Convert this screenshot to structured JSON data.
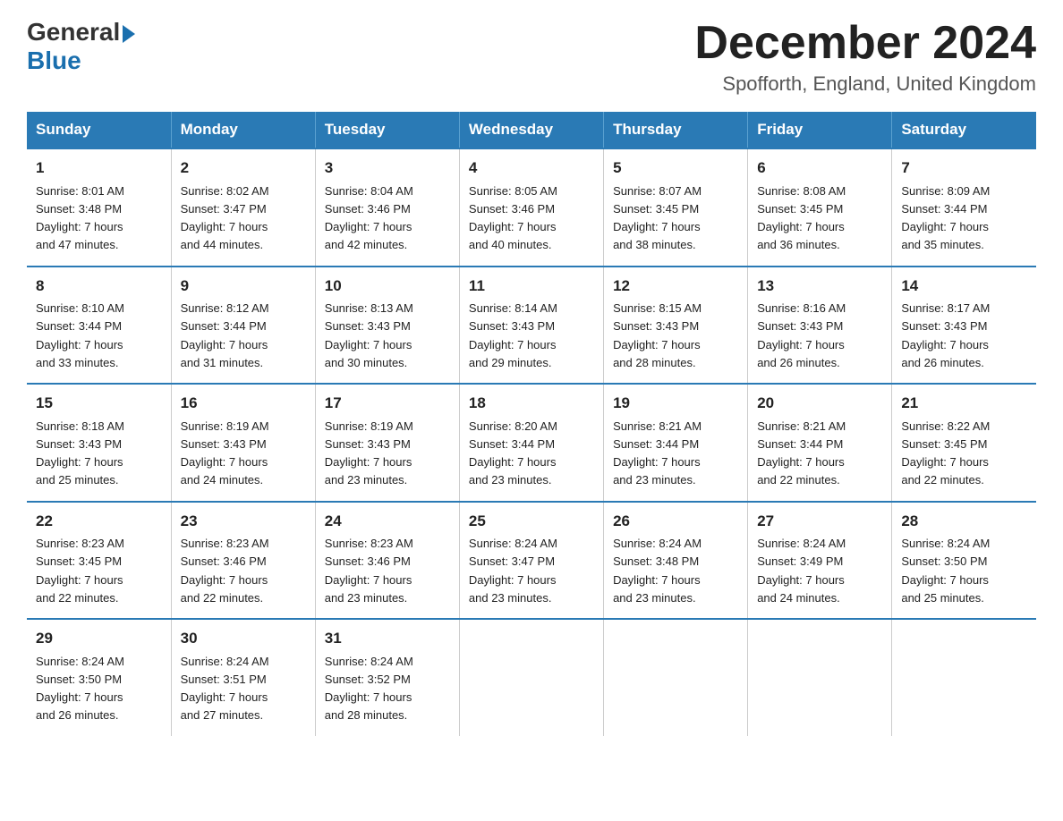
{
  "logo": {
    "general": "General",
    "blue": "Blue"
  },
  "title": "December 2024",
  "location": "Spofforth, England, United Kingdom",
  "days_of_week": [
    "Sunday",
    "Monday",
    "Tuesday",
    "Wednesday",
    "Thursday",
    "Friday",
    "Saturday"
  ],
  "weeks": [
    [
      {
        "day": "1",
        "sunrise": "8:01 AM",
        "sunset": "3:48 PM",
        "daylight": "7 hours and 47 minutes."
      },
      {
        "day": "2",
        "sunrise": "8:02 AM",
        "sunset": "3:47 PM",
        "daylight": "7 hours and 44 minutes."
      },
      {
        "day": "3",
        "sunrise": "8:04 AM",
        "sunset": "3:46 PM",
        "daylight": "7 hours and 42 minutes."
      },
      {
        "day": "4",
        "sunrise": "8:05 AM",
        "sunset": "3:46 PM",
        "daylight": "7 hours and 40 minutes."
      },
      {
        "day": "5",
        "sunrise": "8:07 AM",
        "sunset": "3:45 PM",
        "daylight": "7 hours and 38 minutes."
      },
      {
        "day": "6",
        "sunrise": "8:08 AM",
        "sunset": "3:45 PM",
        "daylight": "7 hours and 36 minutes."
      },
      {
        "day": "7",
        "sunrise": "8:09 AM",
        "sunset": "3:44 PM",
        "daylight": "7 hours and 35 minutes."
      }
    ],
    [
      {
        "day": "8",
        "sunrise": "8:10 AM",
        "sunset": "3:44 PM",
        "daylight": "7 hours and 33 minutes."
      },
      {
        "day": "9",
        "sunrise": "8:12 AM",
        "sunset": "3:44 PM",
        "daylight": "7 hours and 31 minutes."
      },
      {
        "day": "10",
        "sunrise": "8:13 AM",
        "sunset": "3:43 PM",
        "daylight": "7 hours and 30 minutes."
      },
      {
        "day": "11",
        "sunrise": "8:14 AM",
        "sunset": "3:43 PM",
        "daylight": "7 hours and 29 minutes."
      },
      {
        "day": "12",
        "sunrise": "8:15 AM",
        "sunset": "3:43 PM",
        "daylight": "7 hours and 28 minutes."
      },
      {
        "day": "13",
        "sunrise": "8:16 AM",
        "sunset": "3:43 PM",
        "daylight": "7 hours and 26 minutes."
      },
      {
        "day": "14",
        "sunrise": "8:17 AM",
        "sunset": "3:43 PM",
        "daylight": "7 hours and 26 minutes."
      }
    ],
    [
      {
        "day": "15",
        "sunrise": "8:18 AM",
        "sunset": "3:43 PM",
        "daylight": "7 hours and 25 minutes."
      },
      {
        "day": "16",
        "sunrise": "8:19 AM",
        "sunset": "3:43 PM",
        "daylight": "7 hours and 24 minutes."
      },
      {
        "day": "17",
        "sunrise": "8:19 AM",
        "sunset": "3:43 PM",
        "daylight": "7 hours and 23 minutes."
      },
      {
        "day": "18",
        "sunrise": "8:20 AM",
        "sunset": "3:44 PM",
        "daylight": "7 hours and 23 minutes."
      },
      {
        "day": "19",
        "sunrise": "8:21 AM",
        "sunset": "3:44 PM",
        "daylight": "7 hours and 23 minutes."
      },
      {
        "day": "20",
        "sunrise": "8:21 AM",
        "sunset": "3:44 PM",
        "daylight": "7 hours and 22 minutes."
      },
      {
        "day": "21",
        "sunrise": "8:22 AM",
        "sunset": "3:45 PM",
        "daylight": "7 hours and 22 minutes."
      }
    ],
    [
      {
        "day": "22",
        "sunrise": "8:23 AM",
        "sunset": "3:45 PM",
        "daylight": "7 hours and 22 minutes."
      },
      {
        "day": "23",
        "sunrise": "8:23 AM",
        "sunset": "3:46 PM",
        "daylight": "7 hours and 22 minutes."
      },
      {
        "day": "24",
        "sunrise": "8:23 AM",
        "sunset": "3:46 PM",
        "daylight": "7 hours and 23 minutes."
      },
      {
        "day": "25",
        "sunrise": "8:24 AM",
        "sunset": "3:47 PM",
        "daylight": "7 hours and 23 minutes."
      },
      {
        "day": "26",
        "sunrise": "8:24 AM",
        "sunset": "3:48 PM",
        "daylight": "7 hours and 23 minutes."
      },
      {
        "day": "27",
        "sunrise": "8:24 AM",
        "sunset": "3:49 PM",
        "daylight": "7 hours and 24 minutes."
      },
      {
        "day": "28",
        "sunrise": "8:24 AM",
        "sunset": "3:50 PM",
        "daylight": "7 hours and 25 minutes."
      }
    ],
    [
      {
        "day": "29",
        "sunrise": "8:24 AM",
        "sunset": "3:50 PM",
        "daylight": "7 hours and 26 minutes."
      },
      {
        "day": "30",
        "sunrise": "8:24 AM",
        "sunset": "3:51 PM",
        "daylight": "7 hours and 27 minutes."
      },
      {
        "day": "31",
        "sunrise": "8:24 AM",
        "sunset": "3:52 PM",
        "daylight": "7 hours and 28 minutes."
      },
      null,
      null,
      null,
      null
    ]
  ],
  "labels": {
    "sunrise": "Sunrise:",
    "sunset": "Sunset:",
    "daylight": "Daylight:"
  }
}
